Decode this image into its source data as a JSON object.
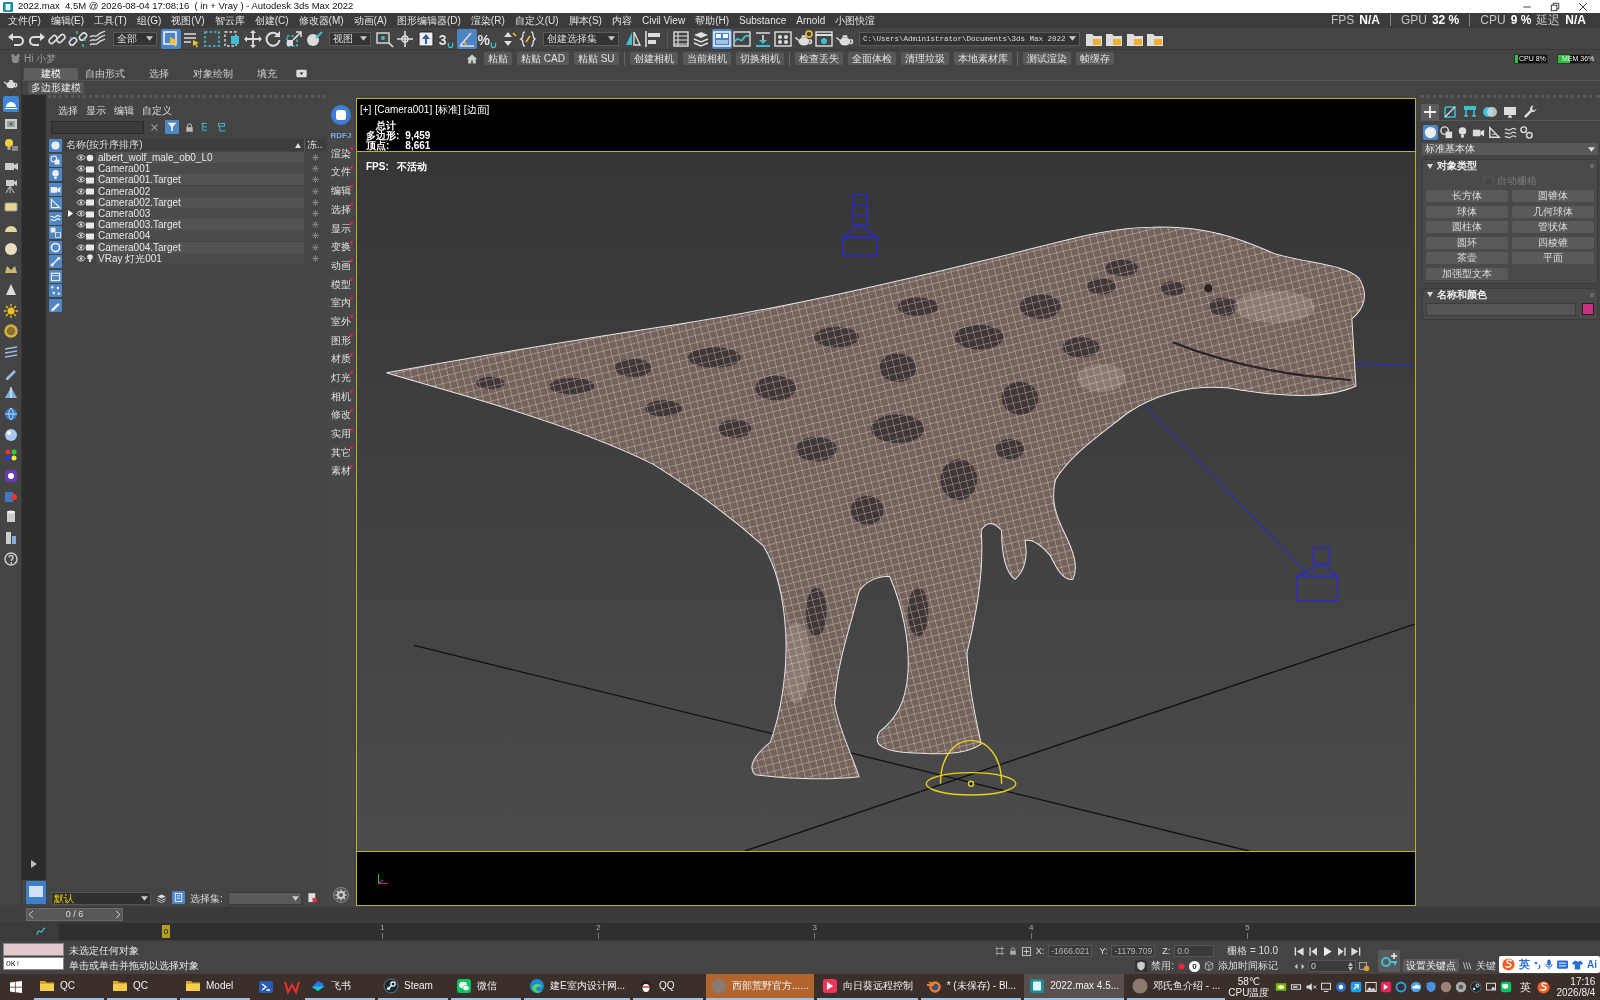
{
  "window": {
    "title": "2022.max  4.5M @ 2026-08-04 17:08:16  ( in + Vray ) - Autodesk 3ds Max 2022"
  },
  "menu_bar": {
    "items": [
      "文件(F)",
      "编辑(E)",
      "工具(T)",
      "组(G)",
      "视图(V)",
      "智云库",
      "创建(C)",
      "修改器(M)",
      "动画(A)",
      "图形编辑器(D)",
      "渲染(R)",
      "自定义(U)",
      "脚本(S)",
      "内容",
      "Civil View",
      "帮助(H)",
      "Substance",
      "Arnold",
      "小图快渲"
    ],
    "stats": [
      {
        "label": "FPS",
        "value": "N/A"
      },
      {
        "label": "GPU",
        "value": "32 %"
      },
      {
        "label": "CPU",
        "value": "9 %"
      },
      {
        "label": "延迟",
        "value": "N/A"
      }
    ]
  },
  "main_toolbar": [
    {
      "kind": "tools",
      "tools": [
        {
          "kind": "undo",
          "on": false
        },
        {
          "kind": "redo",
          "on": false
        },
        {
          "kind": "link",
          "on": false
        },
        {
          "kind": "unlink",
          "on": false
        },
        {
          "kind": "bind",
          "on": false
        }
      ]
    },
    {
      "kind": "dropdown",
      "value": "全部"
    },
    {
      "kind": "tools",
      "tools": [
        {
          "kind": "select",
          "on": true
        },
        {
          "kind": "select_by_name",
          "on": false
        },
        {
          "kind": "rect_region",
          "on": false
        },
        {
          "kind": "window_crossing",
          "on": false
        },
        {
          "kind": "move",
          "on": false
        },
        {
          "kind": "rotate",
          "on": false
        },
        {
          "kind": "scale",
          "on": false
        },
        {
          "kind": "place",
          "on": false
        }
      ]
    },
    {
      "kind": "dropdown",
      "value": "视图"
    },
    {
      "kind": "tools",
      "tools": [
        {
          "kind": "pivot",
          "on": false
        },
        {
          "kind": "manipulate",
          "on": false
        },
        {
          "kind": "override",
          "on": false
        },
        {
          "kind": "snap",
          "label": "3",
          "on": false
        },
        {
          "kind": "angle_snap",
          "on": true
        },
        {
          "kind": "percent_snap",
          "label": "%",
          "on": false
        },
        {
          "kind": "spinner_snap",
          "on": false
        },
        {
          "kind": "named_sel",
          "on": false
        }
      ]
    },
    {
      "kind": "dropdown",
      "value": "创建选择集"
    },
    {
      "kind": "tools",
      "tools": [
        {
          "kind": "mirror",
          "on": false
        },
        {
          "kind": "align",
          "on": false
        }
      ]
    },
    {
      "kind": "tools",
      "tools": [
        {
          "kind": "explorer",
          "on": false
        },
        {
          "kind": "layers",
          "on": false
        },
        {
          "kind": "ribbon",
          "on": true
        },
        {
          "kind": "curve",
          "on": false
        },
        {
          "kind": "schematic",
          "on": false
        },
        {
          "kind": "material",
          "on": false
        },
        {
          "kind": "render_setup",
          "on": false
        },
        {
          "kind": "frame_window",
          "on": false
        },
        {
          "kind": "render",
          "on": false
        }
      ]
    },
    {
      "kind": "dropdown",
      "value": "C:\\Users\\Administrator\\Documents\\3ds Max 2022"
    },
    {
      "kind": "tools",
      "tools": [
        {
          "kind": "project",
          "on": false
        },
        {
          "kind": "project",
          "on": false
        },
        {
          "kind": "project",
          "on": false
        },
        {
          "kind": "project",
          "on": false
        }
      ]
    }
  ],
  "plugin_toolbar": {
    "greeting": "Hi 小梦",
    "groups": [
      [
        "粘贴",
        "粘贴 CAD",
        "粘贴 SU"
      ],
      [
        "创建相机",
        "当前相机",
        "切换相机"
      ],
      [
        "检查丢失",
        "全面体检",
        "清理垃圾",
        "本地素材库"
      ],
      [
        "测试渲染",
        "帧缓存"
      ]
    ],
    "meters": [
      {
        "label": "CPU 8%",
        "level": 0.08
      },
      {
        "label": "MEM 36%",
        "level": 0.36
      }
    ]
  },
  "ribbon": {
    "tabs": [
      {
        "label": "建模",
        "selected": true
      },
      {
        "label": "自由形式",
        "selected": false
      },
      {
        "label": "选择",
        "selected": false
      },
      {
        "label": "对象绘制",
        "selected": false
      },
      {
        "label": "填充",
        "selected": false
      }
    ],
    "panel_label": "多边形建模"
  },
  "left_toolbar": [
    {
      "kind": "teapot",
      "on": false
    },
    {
      "kind": "viewport",
      "on": true
    },
    {
      "kind": "frame",
      "on": false
    },
    {
      "kind": "bulb_screen",
      "on": false
    },
    {
      "kind": "camera",
      "on": false
    },
    {
      "kind": "camera_rig",
      "on": false
    },
    {
      "kind": "plane",
      "on": false
    },
    {
      "kind": "dome",
      "on": false
    },
    {
      "kind": "sphere",
      "on": false
    },
    {
      "kind": "crown",
      "on": false
    },
    {
      "kind": "cone",
      "on": false
    },
    {
      "kind": "sun",
      "on": false
    },
    {
      "kind": "ring",
      "on": false
    },
    {
      "kind": "stripes",
      "on": false
    },
    {
      "kind": "pen",
      "on": false
    },
    {
      "kind": "pyramid",
      "on": false
    },
    {
      "kind": "globe",
      "on": false
    },
    {
      "kind": "ball",
      "on": false
    },
    {
      "kind": "dots",
      "on": false
    },
    {
      "kind": "circle_tile",
      "on": false
    },
    {
      "kind": "tile_dot",
      "on": false
    },
    {
      "kind": "cylinder",
      "on": false
    },
    {
      "kind": "bars",
      "on": false
    },
    {
      "kind": "help",
      "on": false
    }
  ],
  "scene_explorer": {
    "menu": [
      "选择",
      "显示",
      "编辑",
      "自定义"
    ],
    "filter_on": true,
    "filters": [
      {
        "kind": "geometry",
        "on": true
      },
      {
        "kind": "shapes",
        "on": true
      },
      {
        "kind": "lights",
        "on": true
      },
      {
        "kind": "cameras",
        "on": true
      },
      {
        "kind": "helpers",
        "on": true
      },
      {
        "kind": "space_warps",
        "on": true
      },
      {
        "kind": "groups",
        "on": true
      },
      {
        "kind": "xrefs",
        "on": true
      },
      {
        "kind": "bones",
        "on": true
      },
      {
        "kind": "containers",
        "on": true
      },
      {
        "kind": "particles",
        "on": true
      },
      {
        "kind": "hidden",
        "on": true
      }
    ],
    "columns": [
      {
        "label": "名称(按升序排序)",
        "ascending": true
      },
      {
        "label": "冻.."
      }
    ],
    "rows": [
      {
        "name": "albert_wolf_male_ob0_L0",
        "kind": "geometry",
        "current": false
      },
      {
        "name": "Camera001",
        "kind": "camera",
        "current": false
      },
      {
        "name": "Camera001.Target",
        "kind": "camera",
        "current": false
      },
      {
        "name": "Camera002",
        "kind": "camera",
        "current": false
      },
      {
        "name": "Camera002.Target",
        "kind": "camera",
        "current": false
      },
      {
        "name": "Camera003",
        "kind": "camera",
        "current": true
      },
      {
        "name": "Camera003.Target",
        "kind": "camera",
        "current": false
      },
      {
        "name": "Camera004",
        "kind": "camera",
        "current": false
      },
      {
        "name": "Camera004.Target",
        "kind": "camera",
        "current": false
      },
      {
        "name": "VRay 灯光001",
        "kind": "light",
        "current": false
      }
    ],
    "layer": "默认",
    "selection_set_label": "选择集:"
  },
  "plugin_bar": {
    "logo_label": "RDFJ",
    "items": [
      "渲染",
      "文件",
      "编辑",
      "选择",
      "显示",
      "变换",
      "动画",
      "模型",
      "室内",
      "室外",
      "图形",
      "材质",
      "灯光",
      "相机",
      "修改",
      "实用",
      "其它",
      "素材"
    ]
  },
  "viewport": {
    "labels": [
      "[+]",
      "[Camera001]",
      "[标准]",
      "[边面]"
    ],
    "stats_title": "总计",
    "stats": [
      {
        "label": "多边形:",
        "value": "9,459"
      },
      {
        "label": "顶点:",
        "value": "8,661"
      }
    ],
    "fps": {
      "label": "FPS:",
      "value": "不活动"
    }
  },
  "command_panel": {
    "tabs": [
      {
        "kind": "create",
        "selected": true
      },
      {
        "kind": "modify",
        "selected": false
      },
      {
        "kind": "hierarchy",
        "selected": false
      },
      {
        "kind": "motion",
        "selected": false
      },
      {
        "kind": "display",
        "selected": false
      },
      {
        "kind": "utilities",
        "selected": false
      }
    ],
    "categories": [
      {
        "kind": "geometry",
        "selected": true
      },
      {
        "kind": "shapes",
        "selected": false
      },
      {
        "kind": "lights",
        "selected": false
      },
      {
        "kind": "cameras",
        "selected": false
      },
      {
        "kind": "helpers",
        "selected": false
      },
      {
        "kind": "space_warps",
        "selected": false
      },
      {
        "kind": "systems",
        "selected": false
      }
    ],
    "type_dropdown": "标准基本体",
    "rollouts": [
      {
        "kind": "object_type",
        "title": "对象类型",
        "expanded": true,
        "checkbox": {
          "label": "自动栅格",
          "checked": false,
          "disabled": true
        },
        "buttons": [
          "长方体",
          "圆锥体",
          "球体",
          "几何球体",
          "圆柱体",
          "管状体",
          "圆环",
          "四棱锥",
          "茶壶",
          "平面",
          "加强型文本"
        ]
      },
      {
        "kind": "name_color",
        "title": "名称和颜色",
        "expanded": true,
        "color": "#c8307e"
      }
    ]
  },
  "time_slider": {
    "label": "0 / 6",
    "level": 0
  },
  "track_bar": {
    "current": "0",
    "ticks": [
      "1",
      "2",
      "3",
      "4",
      "5"
    ]
  },
  "status_bar": {
    "listener_output": "OK!",
    "messages": [
      "未选定任何对象",
      "单击或单击并拖动以选择对象"
    ],
    "coords": [
      {
        "label": "X:",
        "value": "-1666.021"
      },
      {
        "label": "Y:",
        "value": "-1179.709"
      },
      {
        "label": "Z:",
        "value": "0.0"
      }
    ],
    "grid": "栅格 = 10.0",
    "disable_label": "禁用:",
    "tag_count": "0",
    "add_time_tag": "添加时间标记",
    "frame": "0",
    "set_key": "设置关键点",
    "key_label": "关键"
  },
  "ime_bar": {
    "mode": "英",
    "assistant": "Ai"
  },
  "taskbar": {
    "items": [
      {
        "kind": "folder",
        "label": "QC",
        "selected": false,
        "flashing": false
      },
      {
        "kind": "folder",
        "label": "QC",
        "selected": false,
        "flashing": false
      },
      {
        "kind": "folder",
        "label": "Model",
        "selected": false,
        "flashing": false
      },
      {
        "kind": "terminal",
        "selected": false,
        "flashing": false
      },
      {
        "kind": "wps",
        "selected": false,
        "flashing": false
      },
      {
        "kind": "feishu",
        "label": "飞书",
        "selected": false,
        "flashing": false
      },
      {
        "kind": "steam",
        "label": "Steam",
        "selected": false,
        "flashing": false
      },
      {
        "kind": "wechat",
        "label": "微信",
        "selected": false,
        "flashing": false
      },
      {
        "kind": "edge",
        "label": "建E室内设计网...",
        "selected": false,
        "flashing": false
      },
      {
        "kind": "qq",
        "label": "QQ",
        "selected": false,
        "flashing": false
      },
      {
        "kind": "avatar",
        "label": "西部荒野官方......",
        "selected": false,
        "flashing": true
      },
      {
        "kind": "sunflower",
        "label": "向日葵远程控制",
        "selected": false,
        "flashing": false
      },
      {
        "kind": "blender",
        "label": "* (未保存) - Bl...",
        "selected": false,
        "flashing": false
      },
      {
        "kind": "max",
        "label": "2022.max  4.5...",
        "selected": true,
        "flashing": false
      },
      {
        "kind": "avatar",
        "label": "邓氏鱼介绍 - ...",
        "selected": false,
        "flashing": false
      }
    ],
    "widget": {
      "value": "58℃",
      "label": "CPU温度"
    },
    "language": "英",
    "clock": {
      "time": "17:16",
      "date": "2026/8/4"
    }
  }
}
